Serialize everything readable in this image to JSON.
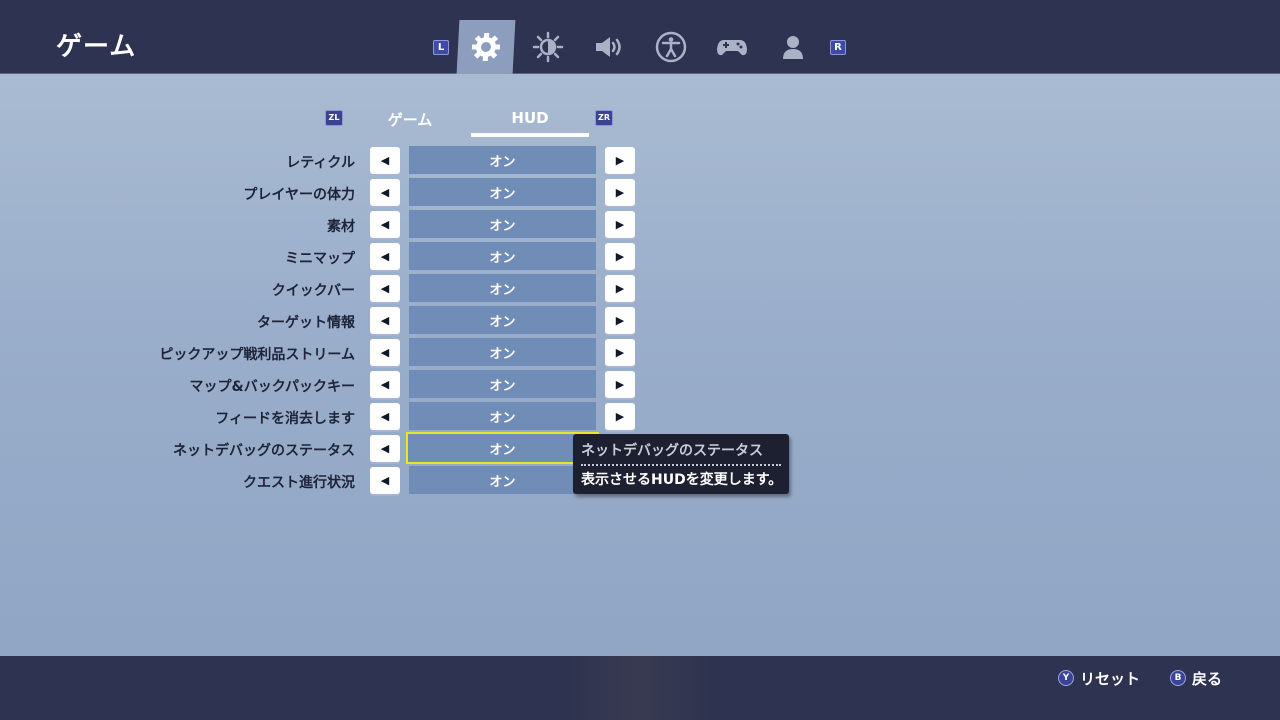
{
  "header": {
    "title": "ゲーム",
    "left_shoulder": "L",
    "right_shoulder": "R",
    "tabs": [
      {
        "icon": "gear-icon"
      },
      {
        "icon": "brightness-icon"
      },
      {
        "icon": "speaker-icon"
      },
      {
        "icon": "accessibility-icon"
      },
      {
        "icon": "gamepad-icon"
      },
      {
        "icon": "user-icon"
      }
    ]
  },
  "subtabs": {
    "left_badge": "ZL",
    "right_badge": "ZR",
    "items": [
      {
        "label": "ゲーム"
      },
      {
        "label": "HUD"
      }
    ]
  },
  "settings": [
    {
      "label": "レティクル",
      "value": "オン"
    },
    {
      "label": "プレイヤーの体力",
      "value": "オン"
    },
    {
      "label": "素材",
      "value": "オン"
    },
    {
      "label": "ミニマップ",
      "value": "オン"
    },
    {
      "label": "クイックバー",
      "value": "オン"
    },
    {
      "label": "ターゲット情報",
      "value": "オン"
    },
    {
      "label": "ピックアップ戦利品ストリーム",
      "value": "オン"
    },
    {
      "label": "マップ&バックパックキー",
      "value": "オン"
    },
    {
      "label": "フィードを消去します",
      "value": "オン"
    },
    {
      "label": "ネットデバッグのステータス",
      "value": "オン"
    },
    {
      "label": "クエスト進行状況",
      "value": "オン"
    }
  ],
  "arrows": {
    "left": "◀",
    "right": "▶"
  },
  "tooltip": {
    "title": "ネットデバッグのステータス",
    "body": "表示させるHUDを変更します。"
  },
  "footer": {
    "reset_button": "Y",
    "reset_label": "リセット",
    "back_button": "B",
    "back_label": "戻る"
  },
  "colors": {
    "header_bg": "#2d3350",
    "value_bg": "#6f8db7",
    "selection": "#e8e82a"
  }
}
